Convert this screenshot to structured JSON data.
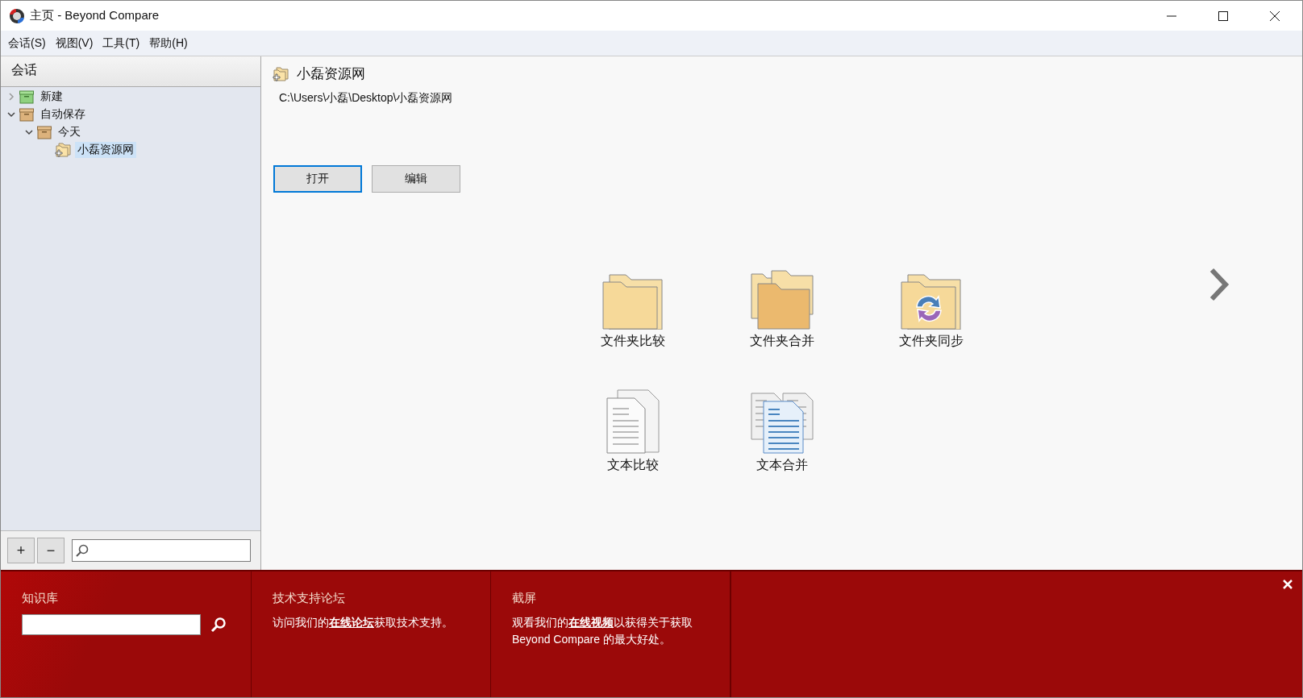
{
  "window": {
    "title": "主页 - Beyond Compare"
  },
  "menu": [
    "会话(S)",
    "视图(V)",
    "工具(T)",
    "帮助(H)"
  ],
  "sidebar": {
    "title": "会话",
    "tree": [
      {
        "label": "新建",
        "kind": "new",
        "expanded": false,
        "selected": false
      },
      {
        "label": "自动保存",
        "kind": "box",
        "expanded": true,
        "selected": false,
        "children": [
          {
            "label": "今天",
            "kind": "box",
            "expanded": true,
            "selected": false,
            "children": [
              {
                "label": "小磊资源网",
                "kind": "session",
                "selected": true
              }
            ]
          }
        ]
      }
    ],
    "add_button": "+",
    "remove_button": "−"
  },
  "session": {
    "title": "小磊资源网",
    "path": "C:\\Users\\小磊\\Desktop\\小磊资源网",
    "buttons": [
      {
        "label": "打开",
        "selected": true
      },
      {
        "label": "编辑",
        "selected": false
      }
    ]
  },
  "launchers": [
    {
      "label": "文件夹比较",
      "kind": "folder-compare"
    },
    {
      "label": "文件夹合并",
      "kind": "folder-merge"
    },
    {
      "label": "文件夹同步",
      "kind": "folder-sync"
    },
    {
      "label": "文本比较",
      "kind": "text-compare"
    },
    {
      "label": "文本合并",
      "kind": "text-merge"
    }
  ],
  "info_bar": {
    "sections": [
      {
        "kind": "search",
        "title": "知识库"
      },
      {
        "kind": "text",
        "title": "技术支持论坛",
        "before": "访问我们的",
        "link": "在线论坛",
        "after": "获取技术支持。"
      },
      {
        "kind": "text",
        "title": "截屏",
        "before": "观看我们的",
        "link": "在线视频",
        "after": "以获得关于获取 Beyond Compare 的最大好处。"
      }
    ]
  }
}
